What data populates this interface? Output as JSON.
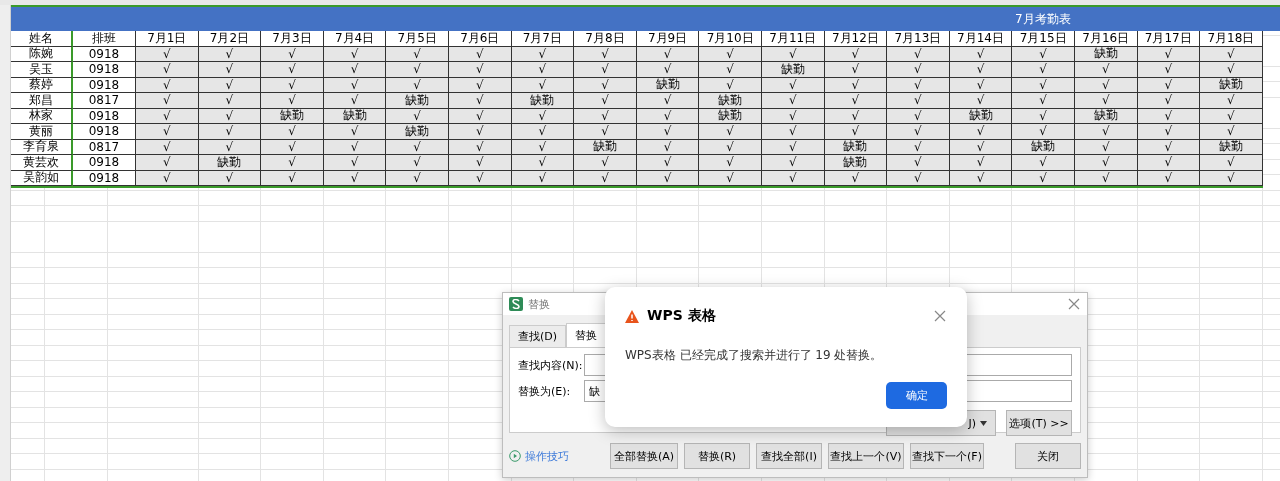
{
  "sheet": {
    "title": "7月考勤表",
    "name_header": "姓名",
    "shift_header": "排班",
    "dates": [
      "7月1日",
      "7月2日",
      "7月3日",
      "7月4日",
      "7月5日",
      "7月6日",
      "7月7日",
      "7月8日",
      "7月9日",
      "7月10日",
      "7月11日",
      "7月12日",
      "7月13日",
      "7月14日",
      "7月15日",
      "7月16日",
      "7月17日",
      "7月18日"
    ],
    "rows": [
      {
        "name": "陈婉",
        "shift": "0918",
        "cells": [
          "√",
          "√",
          "√",
          "√",
          "√",
          "√",
          "√",
          "√",
          "√",
          "√",
          "√",
          "√",
          "√",
          "√",
          "√",
          "缺勤",
          "√",
          "√"
        ]
      },
      {
        "name": "吴玉",
        "shift": "0918",
        "cells": [
          "√",
          "√",
          "√",
          "√",
          "√",
          "√",
          "√",
          "√",
          "√",
          "√",
          "缺勤",
          "√",
          "√",
          "√",
          "√",
          "√",
          "√",
          "√"
        ]
      },
      {
        "name": "蔡婷",
        "shift": "0918",
        "cells": [
          "√",
          "√",
          "√",
          "√",
          "√",
          "√",
          "√",
          "√",
          "缺勤",
          "√",
          "√",
          "√",
          "√",
          "√",
          "√",
          "√",
          "√",
          "缺勤"
        ]
      },
      {
        "name": "郑昌",
        "shift": "0817",
        "cells": [
          "√",
          "√",
          "√",
          "√",
          "缺勤",
          "√",
          "缺勤",
          "√",
          "√",
          "缺勤",
          "√",
          "√",
          "√",
          "√",
          "√",
          "√",
          "√",
          "√"
        ]
      },
      {
        "name": "林家",
        "shift": "0918",
        "cells": [
          "√",
          "√",
          "缺勤",
          "缺勤",
          "√",
          "√",
          "√",
          "√",
          "√",
          "缺勤",
          "√",
          "√",
          "√",
          "缺勤",
          "√",
          "缺勤",
          "√",
          "√"
        ]
      },
      {
        "name": "黄丽",
        "shift": "0918",
        "cells": [
          "√",
          "√",
          "√",
          "√",
          "缺勤",
          "√",
          "√",
          "√",
          "√",
          "√",
          "√",
          "√",
          "√",
          "√",
          "√",
          "√",
          "√",
          "√"
        ]
      },
      {
        "name": "李育泉",
        "shift": "0817",
        "cells": [
          "√",
          "√",
          "√",
          "√",
          "√",
          "√",
          "√",
          "缺勤",
          "√",
          "√",
          "√",
          "缺勤",
          "√",
          "√",
          "缺勤",
          "√",
          "√",
          "缺勤"
        ]
      },
      {
        "name": "黄芸欢",
        "shift": "0918",
        "cells": [
          "√",
          "缺勤",
          "√",
          "√",
          "√",
          "√",
          "√",
          "√",
          "√",
          "√",
          "√",
          "缺勤",
          "√",
          "√",
          "√",
          "√",
          "√",
          "√"
        ]
      },
      {
        "name": "吴韵如",
        "shift": "0918",
        "cells": [
          "√",
          "√",
          "√",
          "√",
          "√",
          "√",
          "√",
          "√",
          "√",
          "√",
          "√",
          "√",
          "√",
          "√",
          "√",
          "√",
          "√",
          "√"
        ]
      }
    ]
  },
  "replace_dialog": {
    "title": "替换",
    "tabs": [
      {
        "label": "查找(D)",
        "selected": false
      },
      {
        "label": "替换",
        "selected": true
      }
    ],
    "find_label": "查找内容(N):",
    "replace_label": "替换为(E):",
    "replace_value": "缺",
    "format_button": "J)",
    "options_button": "选项(T) >>",
    "tips_link": "操作技巧",
    "buttons": [
      "全部替换(A)",
      "替换(R)",
      "查找全部(I)",
      "查找上一个(V)",
      "查找下一个(F)"
    ],
    "close_button": "关闭"
  },
  "alert": {
    "title": "WPS 表格",
    "message": "WPS表格 已经完成了搜索并进行了 19 处替换。",
    "ok_button": "确定"
  }
}
